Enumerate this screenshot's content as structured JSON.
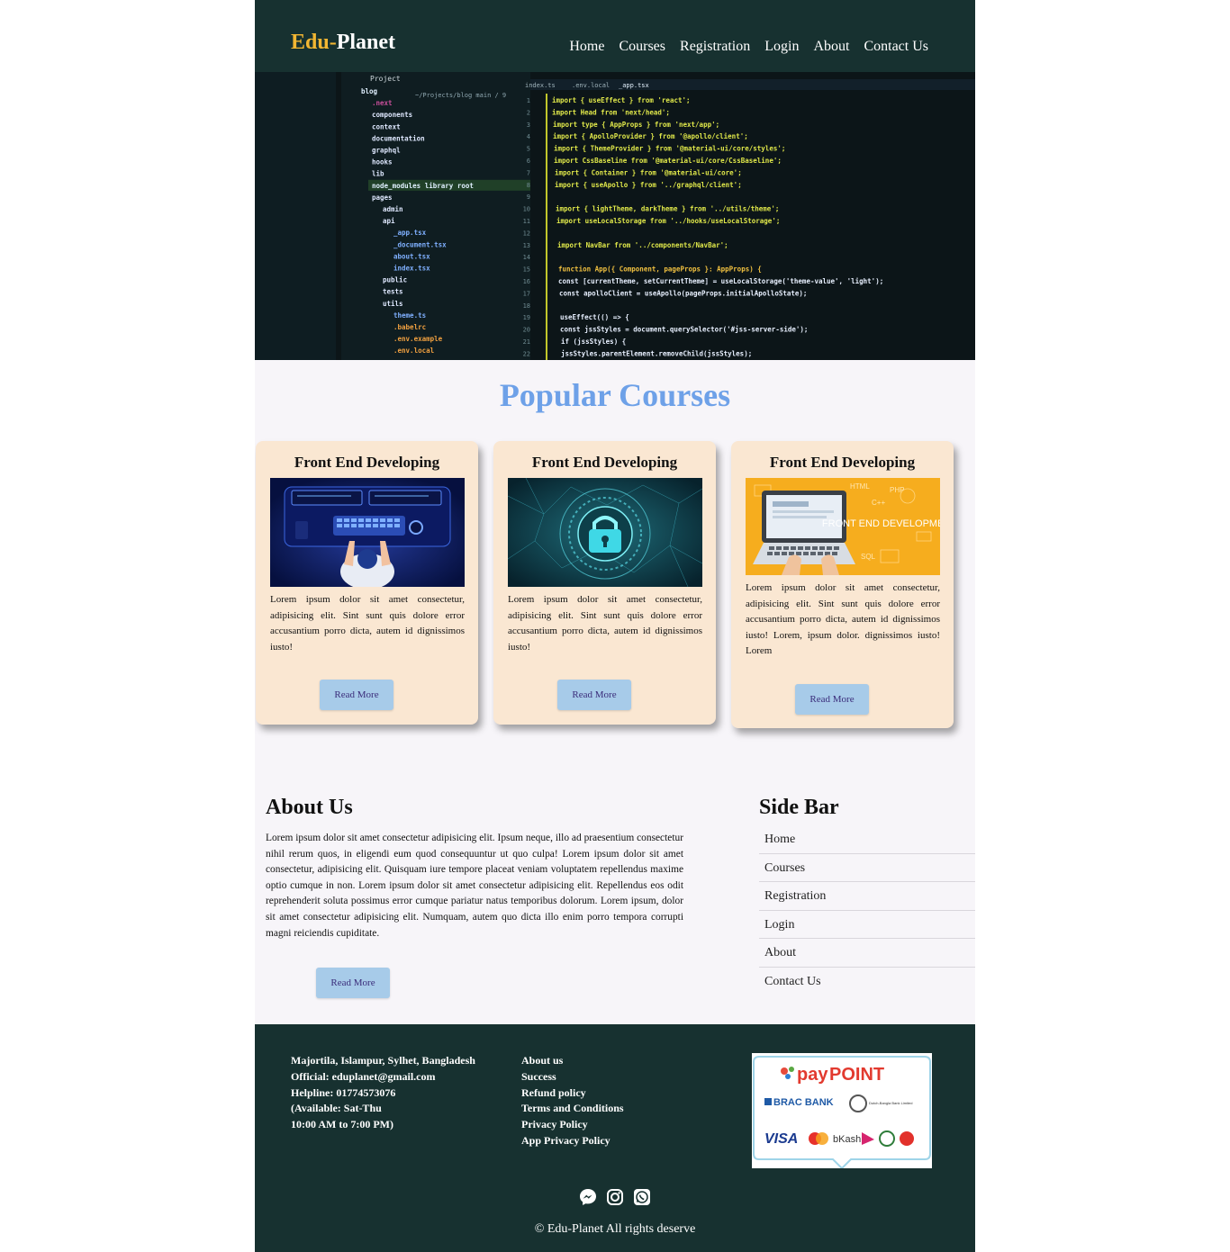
{
  "brand": {
    "part1": "Edu-",
    "part2": "Planet"
  },
  "nav": [
    "Home",
    "Courses",
    "Registration",
    "Login",
    "About",
    "Contact Us"
  ],
  "hero": {
    "project_label": "Project",
    "branch": "~/Projects/blog main / 9",
    "tabs": [
      "index.ts",
      ".env.local",
      "_app.tsx"
    ],
    "tree": [
      "blog",
      ".next",
      "components",
      "context",
      "documentation",
      "graphql",
      "hooks",
      "lib",
      "node_modules library root",
      "pages",
      "admin",
      "api",
      "_app.tsx",
      "_document.tsx",
      "about.tsx",
      "index.tsx",
      "public",
      "tests",
      "utils",
      "theme.ts",
      ".babelrc",
      ".env.example",
      ".env.local"
    ],
    "code": [
      "import { useEffect } from 'react';",
      "import Head from 'next/head';",
      "import type { AppProps } from 'next/app';",
      "import { ApolloProvider } from '@apollo/client';",
      "import { ThemeProvider } from '@material-ui/core/styles';",
      "import CssBaseline from '@material-ui/core/CssBaseline';",
      "import { Container } from '@material-ui/core';",
      "import { useApollo } from '../graphql/client';",
      "",
      "import { lightTheme, darkTheme } from '../utils/theme';",
      "import useLocalStorage from '../hooks/useLocalStorage';",
      "",
      "import NavBar from '../components/NavBar';",
      "",
      "function App({ Component, pageProps }: AppProps) {",
      "  const [currentTheme, setCurrentTheme] = useLocalStorage('theme-value', 'light');",
      "  const apolloClient = useApollo(pageProps.initialApolloState);",
      "",
      "  useEffect(() => {",
      "    const jssStyles = document.querySelector('#jss-server-side');",
      "    if (jssStyles) {",
      "      jssStyles.parentElement.removeChild(jssStyles);"
    ]
  },
  "courses": {
    "title": "Popular Courses",
    "cards": [
      {
        "title": "Front End Developing",
        "text": "Lorem ipsum dolor sit amet consectetur, adipisicing elit. Sint sunt quis dolore error accusantium porro dicta, autem id dignissimos iusto!",
        "button": "Read More"
      },
      {
        "title": "Front End Developing",
        "text": "Lorem ipsum dolor sit amet consectetur, adipisicing elit. Sint sunt quis dolore error accusantium porro dicta, autem id dignissimos iusto!",
        "button": "Read More"
      },
      {
        "title": "Front End Developing",
        "text": "Lorem ipsum dolor sit amet consectetur, adipisicing elit. Sint sunt quis dolore error accusantium porro dicta, autem id dignissimos iusto! Lorem, ipsum dolor. dignissimos iusto! Lorem",
        "button": "Read More",
        "image_caption": "FRONT END DEVELOPMENT"
      }
    ]
  },
  "about": {
    "title": "About Us",
    "text": "Lorem ipsum dolor sit amet consectetur adipisicing elit. Ipsum neque, illo ad praesentium consectetur nihil rerum quos, in eligendi eum quod consequuntur ut quo culpa! Lorem ipsum dolor sit amet consectetur, adipisicing elit. Quisquam iure tempore placeat veniam voluptatem repellendus maxime optio cumque in non. Lorem ipsum dolor sit amet consectetur adipisicing elit. Repellendus eos odit reprehenderit soluta possimus error cumque pariatur natus temporibus dolorum. Lorem ipsum, dolor sit amet consectetur adipisicing elit. Numquam, autem quo dicta illo enim porro tempora corrupti magni reiciendis cupiditate.",
    "button": "Read More"
  },
  "sidebar": {
    "title": "Side Bar",
    "items": [
      "Home",
      "Courses",
      "Registration",
      "Login",
      "About",
      "Contact Us"
    ]
  },
  "footer": {
    "address": [
      "Majortila, Islampur, Sylhet, Bangladesh",
      "Official: eduplanet@gmail.com",
      "Helpline: 01774573076",
      "(Available: Sat-Thu",
      "10:00 AM to 7:00 PM)"
    ],
    "links": [
      "About us",
      "Success",
      "Refund policy",
      "Terms and Conditions",
      "Privacy Policy",
      "App Privacy Policy"
    ],
    "payment": {
      "title_a": "pay",
      "title_b": "POINT",
      "bank": "BRAC BANK",
      "bank_sub": "Dutch-Bangla Bank Limited",
      "cards": [
        "VISA",
        "bKash"
      ]
    },
    "socials": [
      "messenger-icon",
      "instagram-icon",
      "whatsapp-icon"
    ],
    "copyright": "© Edu-Planet All rights deserve"
  },
  "colors": {
    "header_bg": "#173130",
    "accent": "#f2b632",
    "title_blue": "#6ea1e8",
    "card_bg": "#fae7d2",
    "button_bg": "#a7cbe9"
  }
}
